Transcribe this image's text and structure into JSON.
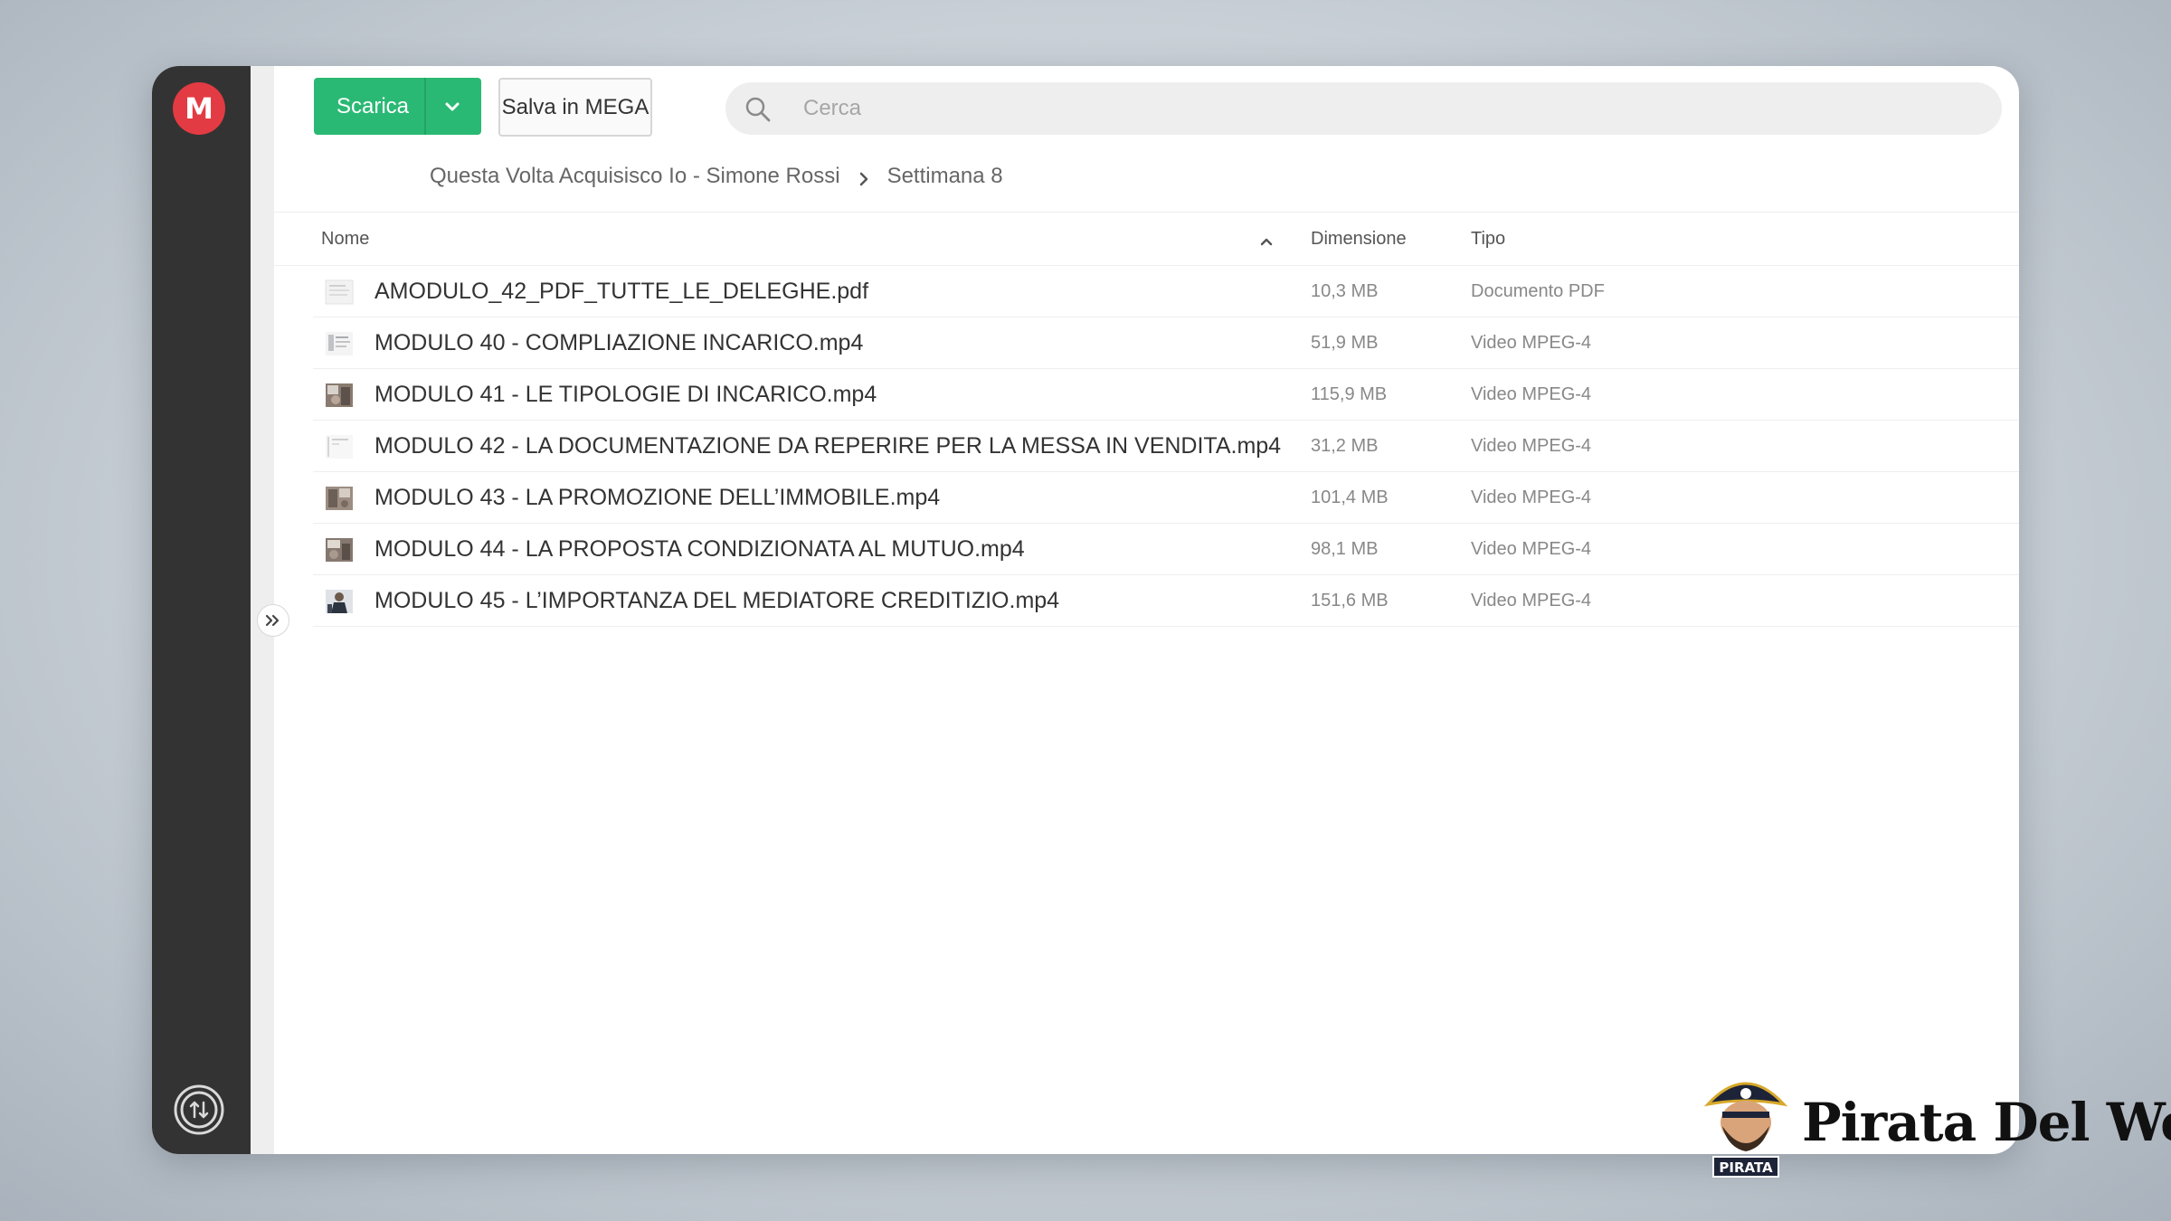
{
  "sidebar": {
    "logo_letter": "M",
    "logo_icon": "mega-logo-icon",
    "transfer_icon": "transfer-manager-icon"
  },
  "toolbar": {
    "download_label": "Scarica",
    "download_dropdown_icon": "chevron-down-icon",
    "save_label": "Salva in MEGA"
  },
  "search": {
    "placeholder": "Cerca",
    "icon": "search-icon"
  },
  "breadcrumb": {
    "items": [
      "Questa Volta Acquisisco Io - Simone Rossi",
      "Settimana 8"
    ],
    "separator_icon": "chevron-right-icon"
  },
  "columns": {
    "name": "Nome",
    "size": "Dimensione",
    "type": "Tipo",
    "sort_icon": "chevron-up-icon"
  },
  "files": [
    {
      "name": "AMODULO_42_PDF_TUTTE_LE_DELEGHE.pdf",
      "size": "10,3 MB",
      "type": "Documento PDF",
      "thumb": "pdf-document-thumbnail"
    },
    {
      "name": "MODULO 40 - COMPLIAZIONE INCARICO.mp4",
      "size": "51,9 MB",
      "type": "Video MPEG-4",
      "thumb": "video-thumbnail"
    },
    {
      "name": "MODULO 41 - LE TIPOLOGIE DI INCARICO.mp4",
      "size": "115,9 MB",
      "type": "Video MPEG-4",
      "thumb": "video-thumbnail"
    },
    {
      "name": "MODULO 42 - LA DOCUMENTAZIONE DA REPERIRE PER LA MESSA IN VENDITA.mp4",
      "size": "31,2 MB",
      "type": "Video MPEG-4",
      "thumb": "video-thumbnail"
    },
    {
      "name": "MODULO 43 - LA PROMOZIONE DELL’IMMOBILE.mp4",
      "size": "101,4 MB",
      "type": "Video MPEG-4",
      "thumb": "video-thumbnail"
    },
    {
      "name": "MODULO 44 - LA PROPOSTA CONDIZIONATA AL MUTUO.mp4",
      "size": "98,1 MB",
      "type": "Video MPEG-4",
      "thumb": "video-thumbnail"
    },
    {
      "name": "MODULO 45 - L’IMPORTANZA DEL MEDIATORE CREDITIZIO.mp4",
      "size": "151,6 MB",
      "type": "Video MPEG-4",
      "thumb": "video-thumbnail"
    }
  ],
  "expand_icon": "double-chevron-right-icon",
  "watermark": {
    "text": "Pirata Del Web",
    "badge": "PIRATA"
  },
  "colors": {
    "accent_green": "#2ab974",
    "mega_red": "#e33b43",
    "sidebar_dark": "#333333"
  }
}
